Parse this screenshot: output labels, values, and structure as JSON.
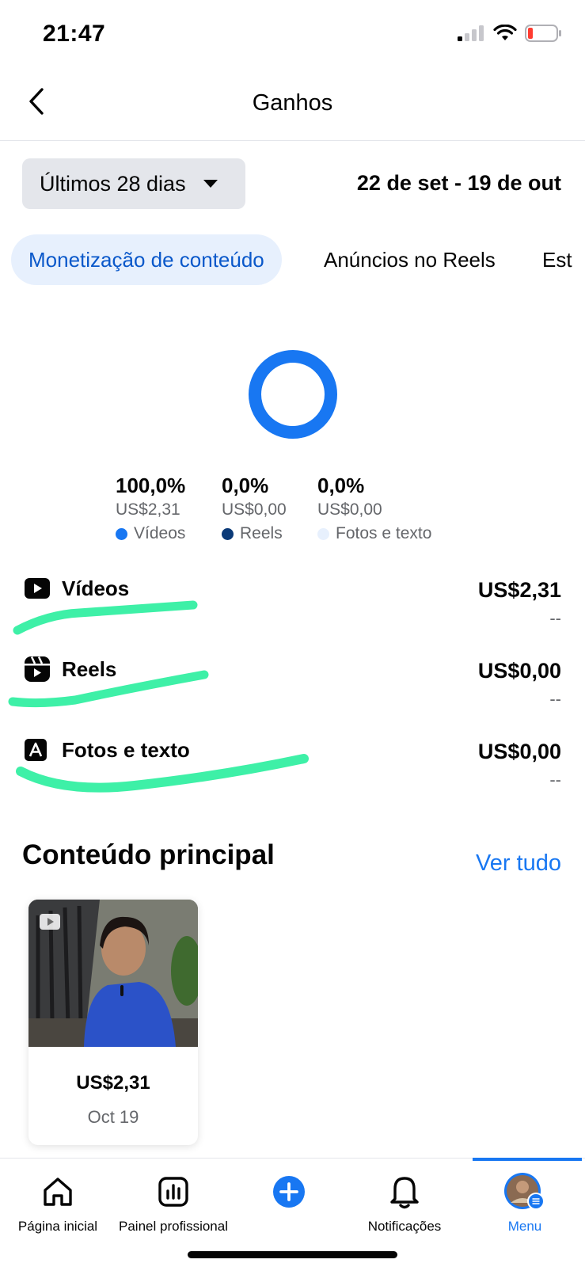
{
  "status_bar": {
    "time": "21:47"
  },
  "header": {
    "title": "Ganhos"
  },
  "filters": {
    "period": "Últimos 28 dias",
    "date_range": "22 de set - 19 de out"
  },
  "tabs": [
    {
      "label": "Monetização de conteúdo",
      "active": true
    },
    {
      "label": "Anúncios no Reels",
      "active": false
    },
    {
      "label": "Est",
      "active": false
    }
  ],
  "breakdown": [
    {
      "percent": "100,0%",
      "amount": "US$2,31",
      "legend": "Vídeos",
      "color": "#1877f2",
      "share": 1.0
    },
    {
      "percent": "0,0%",
      "amount": "US$0,00",
      "legend": "Reels",
      "color": "#0b3a78",
      "share": 0.0
    },
    {
      "percent": "0,0%",
      "amount": "US$0,00",
      "legend": "Fotos e texto",
      "color": "#e7f0fd",
      "share": 0.0
    }
  ],
  "rows": [
    {
      "icon": "video-icon",
      "label": "Vídeos",
      "amount": "US$2,31",
      "delta": "--"
    },
    {
      "icon": "reels-icon",
      "label": "Reels",
      "amount": "US$0,00",
      "delta": "--"
    },
    {
      "icon": "text-icon",
      "label": "Fotos e texto",
      "amount": "US$0,00",
      "delta": "--"
    }
  ],
  "top_content": {
    "title": "Conteúdo principal",
    "see_all": "Ver tudo",
    "items": [
      {
        "amount": "US$2,31",
        "date": "Oct 19"
      }
    ]
  },
  "bottom_nav": [
    {
      "icon": "home-icon",
      "label": "Página inicial"
    },
    {
      "icon": "dashboard-icon",
      "label": "Painel profissional"
    },
    {
      "icon": "create-icon",
      "label": ""
    },
    {
      "icon": "bell-icon",
      "label": "Notificações"
    },
    {
      "icon": "profile-menu-icon",
      "label": "Menu",
      "active": true
    }
  ],
  "colors": {
    "accent": "#1877f2",
    "highlight": "#3ef0a7"
  }
}
